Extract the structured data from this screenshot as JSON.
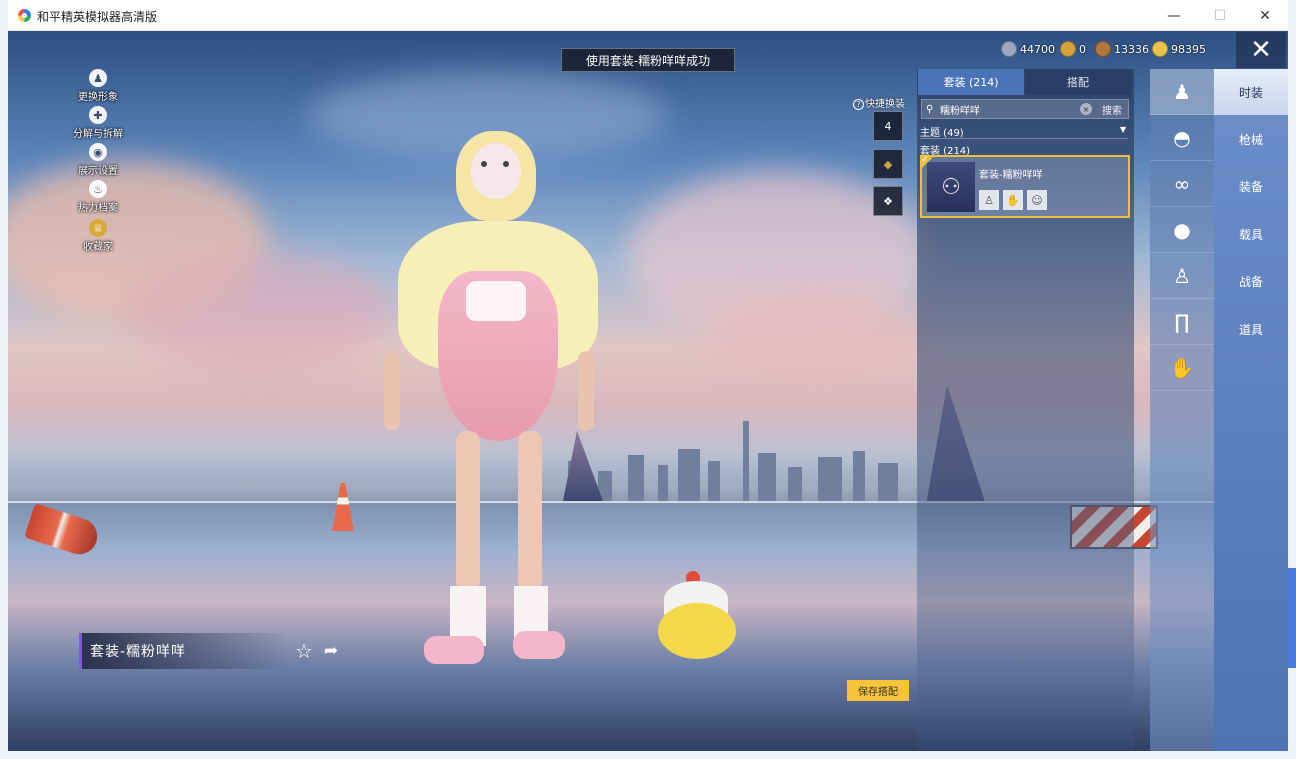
{
  "window": {
    "title": "和平精英模拟器高清版",
    "min_glyph": "—",
    "max_glyph": "☐",
    "close_glyph": "✕"
  },
  "toast": "使用套装-糯粉咩咩成功",
  "left_menu": [
    {
      "label": "更换形象",
      "icon": "person-icon",
      "glyph": "♟"
    },
    {
      "label": "分解与拆解",
      "icon": "puzzle-icon",
      "glyph": "✚"
    },
    {
      "label": "展示设置",
      "icon": "eye-icon",
      "glyph": "◉"
    },
    {
      "label": "热力档案",
      "icon": "flame-icon",
      "glyph": "♨"
    },
    {
      "label": "收藏家",
      "icon": "collector-badge-icon",
      "glyph": "♕"
    }
  ],
  "currencies": [
    {
      "value": "44700",
      "icon": "silver-coin-icon",
      "color": "#9aa6c2"
    },
    {
      "value": "0",
      "icon": "gold-token-icon",
      "color": "#d6a43a"
    },
    {
      "value": "13336",
      "icon": "bronze-coin-icon",
      "color": "#b0783c"
    },
    {
      "value": "98395",
      "icon": "gold-coin-icon",
      "color": "#e9c34b"
    }
  ],
  "close_glyph": "✕",
  "quick_change": {
    "label": "快捷换装",
    "help_glyph": "?",
    "slots": [
      {
        "icon": "hanger-icon",
        "text": "4"
      },
      {
        "icon": "emblem-icon",
        "text": "◆"
      },
      {
        "icon": "wings-icon",
        "text": "❖"
      }
    ]
  },
  "outfit_name": "套装-糯粉咩咩",
  "fav_glyph": "☆",
  "share_glyph": "➦",
  "save_button": "保存搭配",
  "panel": {
    "tab_active": "套装 (214)",
    "tab_inactive": "搭配",
    "search_value": "糯粉咩咩",
    "search_button": "搜索",
    "search_glyph": "⚲",
    "clear_glyph": "×",
    "theme_row": "主题 (49)",
    "suit_row": "套装 (214)",
    "caret": "▼",
    "card_name": "套装-糯粉咩咩",
    "card_check": "✓",
    "card_thumb_glyph": "⚇",
    "card_minis": [
      "♙",
      "✋",
      "☺"
    ]
  },
  "icon_column": [
    {
      "icon": "outfit-icon",
      "glyph": "♟"
    },
    {
      "icon": "cap-icon",
      "glyph": "◓"
    },
    {
      "icon": "glasses-icon",
      "glyph": "∞"
    },
    {
      "icon": "face-icon",
      "glyph": "●"
    },
    {
      "icon": "top-icon",
      "glyph": "♙"
    },
    {
      "icon": "pants-icon",
      "glyph": "∏"
    },
    {
      "icon": "shoes-icon",
      "glyph": "✋"
    }
  ],
  "categories": [
    "时装",
    "枪械",
    "装备",
    "载具",
    "战备",
    "道具"
  ]
}
